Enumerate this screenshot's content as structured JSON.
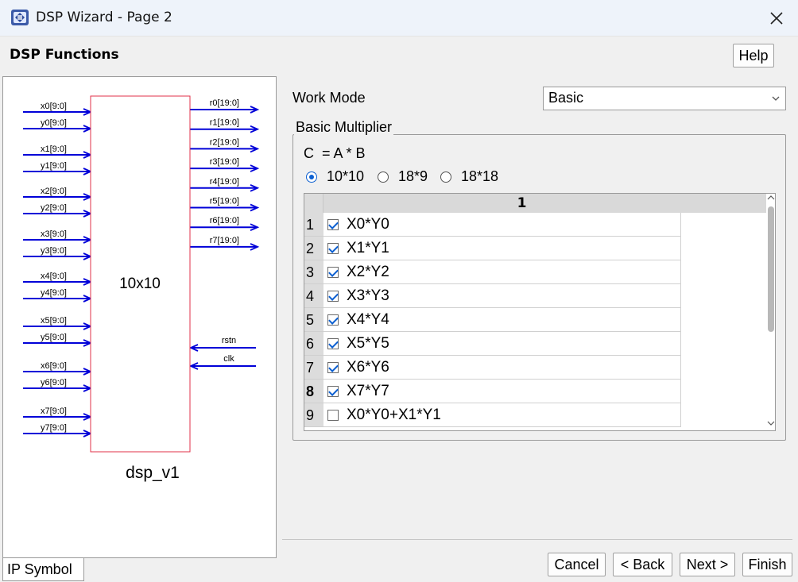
{
  "window": {
    "title": "DSP Wizard - Page 2"
  },
  "header": {
    "section_title": "DSP Functions",
    "help_label": "Help"
  },
  "symbol": {
    "tab_label": "IP Symbol",
    "inputs": [
      "x0[9:0]",
      "y0[9:0]",
      "x1[9:0]",
      "y1[9:0]",
      "x2[9:0]",
      "y2[9:0]",
      "x3[9:0]",
      "y3[9:0]",
      "x4[9:0]",
      "y4[9:0]",
      "x5[9:0]",
      "y5[9:0]",
      "x6[9:0]",
      "y6[9:0]",
      "x7[9:0]",
      "y7[9:0]"
    ],
    "outputs": [
      "r0[19:0]",
      "r1[19:0]",
      "r2[19:0]",
      "r3[19:0]",
      "r4[19:0]",
      "r5[19:0]",
      "r6[19:0]",
      "r7[19:0]"
    ],
    "control_inputs": [
      "rstn",
      "clk"
    ],
    "block_label": "10x10",
    "instance_name": "dsp_v1",
    "wire_color": "#0000d8",
    "block_border_color": "#e0304a"
  },
  "work_mode": {
    "label": "Work Mode",
    "value": "Basic"
  },
  "basic_multiplier": {
    "group_label": "Basic Multiplier",
    "formula": "C  = A * B",
    "options": [
      {
        "label": "10*10",
        "selected": true
      },
      {
        "label": "18*9",
        "selected": false
      },
      {
        "label": "18*18",
        "selected": false
      }
    ],
    "table": {
      "column_header": "1",
      "rows": [
        {
          "num": "1",
          "checked": true,
          "text": "X0*Y0"
        },
        {
          "num": "2",
          "checked": true,
          "text": "X1*Y1"
        },
        {
          "num": "3",
          "checked": true,
          "text": "X2*Y2"
        },
        {
          "num": "4",
          "checked": true,
          "text": "X3*Y3"
        },
        {
          "num": "5",
          "checked": true,
          "text": "X4*Y4"
        },
        {
          "num": "6",
          "checked": true,
          "text": "X5*Y5"
        },
        {
          "num": "7",
          "checked": true,
          "text": "X6*Y6"
        },
        {
          "num": "8",
          "checked": true,
          "text": "X7*Y7"
        },
        {
          "num": "9",
          "checked": false,
          "text": "X0*Y0+X1*Y1"
        }
      ]
    }
  },
  "footer": {
    "cancel": "Cancel",
    "back": "< Back",
    "next": "Next >",
    "finish": "Finish"
  }
}
